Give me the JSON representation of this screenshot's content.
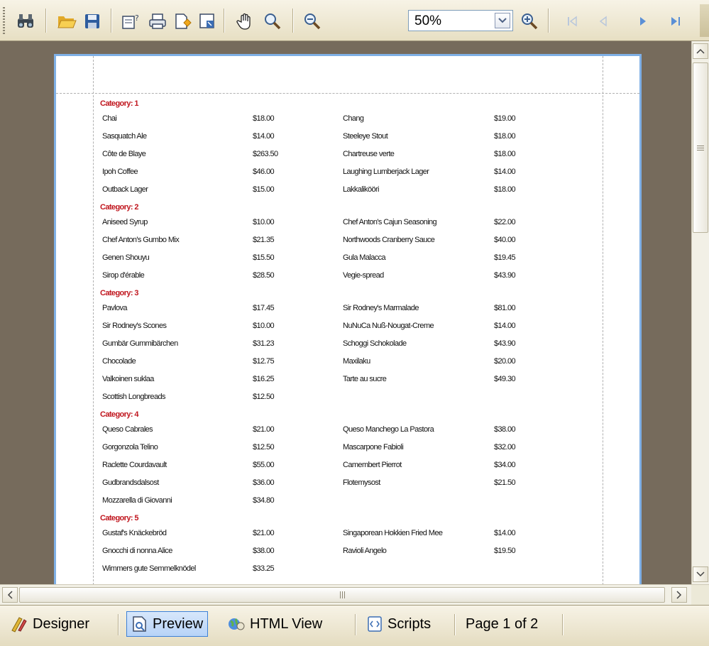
{
  "toolbar": {
    "zoom_value": "50%",
    "icons": [
      "binoculars-icon",
      "open-folder-icon",
      "save-icon",
      "page-setup-icon",
      "print-icon",
      "export-icon",
      "page-icon",
      "hand-icon",
      "zoom-glass-icon",
      "zoom-out-icon",
      "zoom-in-icon",
      "first-page-icon",
      "prev-page-icon",
      "next-page-icon",
      "last-page-icon"
    ]
  },
  "report": {
    "groups": [
      {
        "label": "Category: 1",
        "rows": [
          [
            "Chai",
            "$18.00",
            "Chang",
            "$19.00"
          ],
          [
            "Sasquatch Ale",
            "$14.00",
            "Steeleye Stout",
            "$18.00"
          ],
          [
            "Côte de Blaye",
            "$263.50",
            "Chartreuse verte",
            "$18.00"
          ],
          [
            "Ipoh Coffee",
            "$46.00",
            "Laughing Lumberjack Lager",
            "$14.00"
          ],
          [
            "Outback Lager",
            "$15.00",
            "Lakkalikööri",
            "$18.00"
          ]
        ]
      },
      {
        "label": "Category: 2",
        "rows": [
          [
            "Aniseed Syrup",
            "$10.00",
            "Chef Anton's Cajun Seasoning",
            "$22.00"
          ],
          [
            "Chef Anton's Gumbo Mix",
            "$21.35",
            "Northwoods Cranberry Sauce",
            "$40.00"
          ],
          [
            "Genen Shouyu",
            "$15.50",
            "Gula Malacca",
            "$19.45"
          ],
          [
            "Sirop d'érable",
            "$28.50",
            "Vegie-spread",
            "$43.90"
          ]
        ]
      },
      {
        "label": "Category: 3",
        "rows": [
          [
            "Pavlova",
            "$17.45",
            "Sir Rodney's Marmalade",
            "$81.00"
          ],
          [
            "Sir Rodney's Scones",
            "$10.00",
            "NuNuCa Nuß-Nougat-Creme",
            "$14.00"
          ],
          [
            "Gumbär Gummibärchen",
            "$31.23",
            "Schoggi Schokolade",
            "$43.90"
          ],
          [
            "Chocolade",
            "$12.75",
            "Maxilaku",
            "$20.00"
          ],
          [
            "Valkoinen suklaa",
            "$16.25",
            "Tarte au sucre",
            "$49.30"
          ],
          [
            "Scottish Longbreads",
            "$12.50",
            "",
            ""
          ]
        ]
      },
      {
        "label": "Category: 4",
        "rows": [
          [
            "Queso Cabrales",
            "$21.00",
            "Queso Manchego La Pastora",
            "$38.00"
          ],
          [
            "Gorgonzola Telino",
            "$12.50",
            "Mascarpone Fabioli",
            "$32.00"
          ],
          [
            "Raclette Courdavault",
            "$55.00",
            "Camembert Pierrot",
            "$34.00"
          ],
          [
            "Gudbrandsdalsost",
            "$36.00",
            "Flotemysost",
            "$21.50"
          ],
          [
            "Mozzarella di Giovanni",
            "$34.80",
            "",
            ""
          ]
        ]
      },
      {
        "label": "Category: 5",
        "rows": [
          [
            "Gustaf's Knäckebröd",
            "$21.00",
            "Singaporean Hokkien Fried Mee",
            "$14.00"
          ],
          [
            "Gnocchi di nonna Alice",
            "$38.00",
            "Ravioli Angelo",
            "$19.50"
          ],
          [
            "Wimmers gute Semmelknödel",
            "$33.25",
            "",
            ""
          ]
        ]
      }
    ]
  },
  "tabs": {
    "designer": "Designer",
    "preview": "Preview",
    "html_view": "HTML View",
    "scripts": "Scripts",
    "page_status": "Page 1 of 2"
  },
  "colors": {
    "category_label": "#c0161e",
    "workspace": "#766b5c",
    "page_border": "#7fb0e6",
    "active_tab": "#b7d3f7"
  }
}
